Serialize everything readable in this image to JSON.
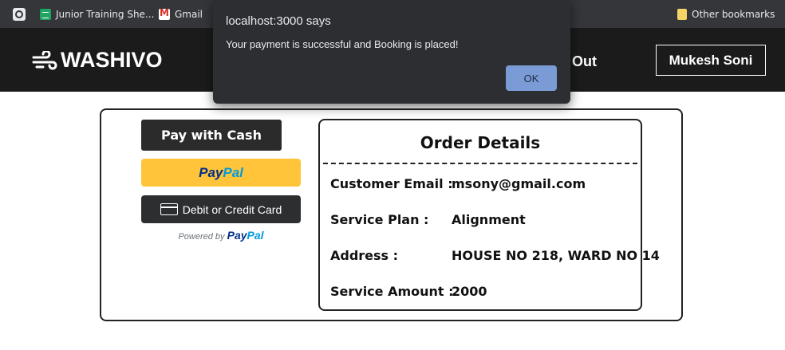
{
  "bookmarks": {
    "items": [
      {
        "label": "",
        "icon": "search-icon"
      },
      {
        "label": "Junior Training She...",
        "icon": "sheets-icon"
      },
      {
        "label": "Gmail",
        "icon": "gmail-icon"
      }
    ],
    "other": {
      "label": "Other bookmarks",
      "icon": "folder-icon"
    }
  },
  "header": {
    "logo_text": "WASHIVO",
    "logout_label": "og Out",
    "user_name": "Mukesh Soni"
  },
  "payment": {
    "cash_label": "Pay with Cash",
    "paypal_dark": "Pay",
    "paypal_light": "Pal",
    "card_label": "Debit or Credit Card",
    "powered_by": "Powered by",
    "powered_pay": "Pay",
    "powered_pal": "Pal"
  },
  "order": {
    "title": "Order Details",
    "rows": [
      {
        "label": "Customer Email :",
        "value": "msony@gmail.com"
      },
      {
        "label": "Service Plan :",
        "value": "Alignment"
      },
      {
        "label": "Address :",
        "value": "HOUSE NO 218, WARD NO 14"
      },
      {
        "label": "Service Amount :",
        "value": "2000"
      }
    ]
  },
  "dialog": {
    "title": "localhost:3000 says",
    "message": "Your payment is successful and Booking is placed!",
    "ok_label": "OK"
  },
  "colors": {
    "header_bg": "#1b1b1b",
    "bookmarks_bg": "#35363a",
    "paypal_yellow": "#ffc439",
    "paypal_dark": "#003087",
    "paypal_light": "#009cde",
    "dialog_bg": "#2d2e31",
    "ok_button": "#7a9bd6"
  }
}
